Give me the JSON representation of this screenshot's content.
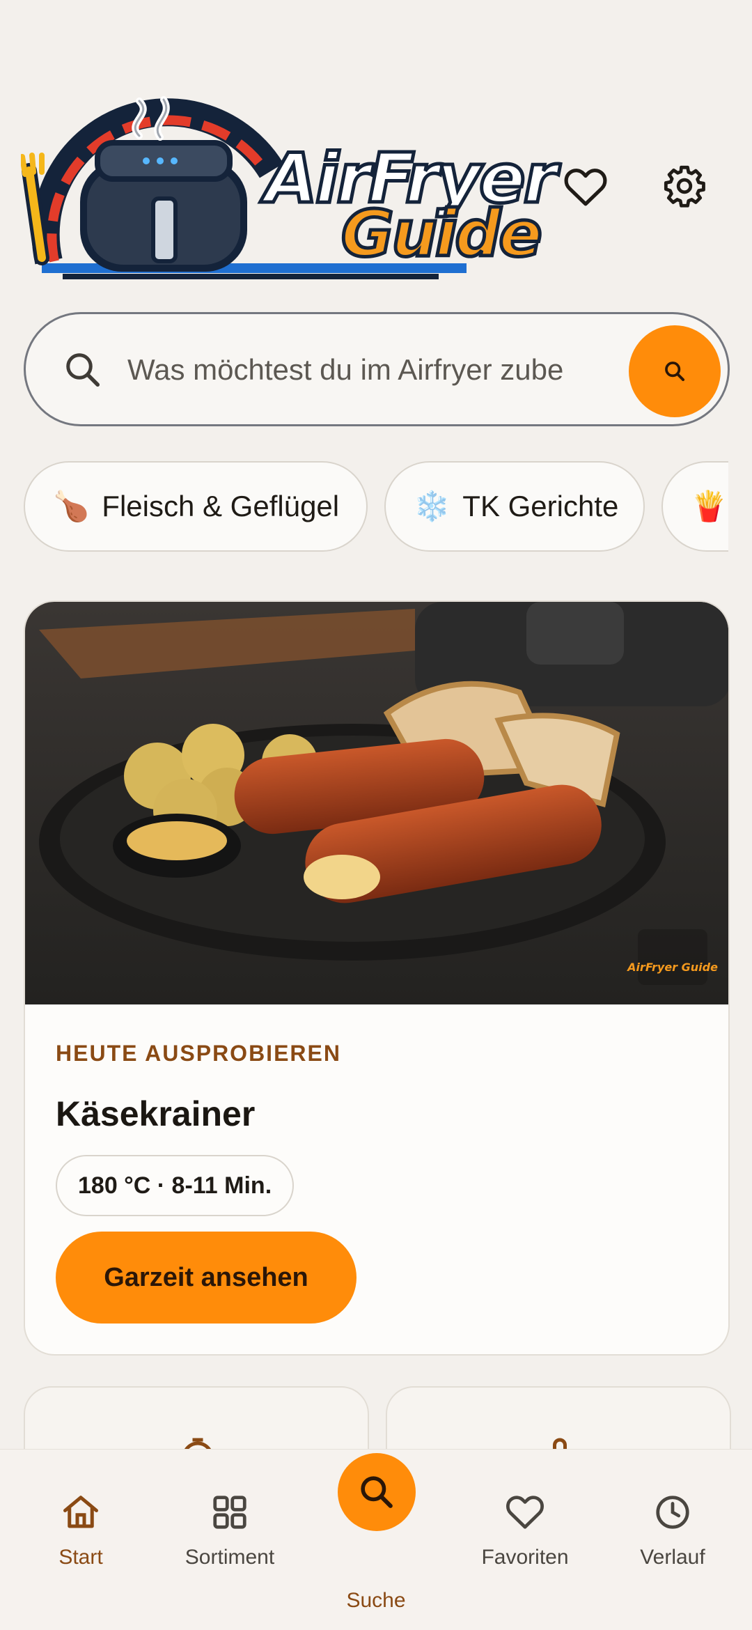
{
  "header": {
    "logo_text_line1": "AirFryer",
    "logo_text_line2": "Guide",
    "icons": [
      "heart-icon",
      "gear-icon"
    ]
  },
  "search": {
    "placeholder": "Was möchtest du im Airfryer zube",
    "button_icon": "search-icon"
  },
  "chips": [
    {
      "emoji": "🍗",
      "label": "Fleisch & Geflügel"
    },
    {
      "emoji": "❄️",
      "label": "TK Gerichte"
    },
    {
      "emoji": "🍟",
      "label": ""
    }
  ],
  "featured": {
    "eyebrow": "HEUTE AUSPROBIEREN",
    "title": "Käsekrainer",
    "meta": "180 °C · 8-11 Min.",
    "cta": "Garzeit ansehen",
    "watermark_text": "AirFryer Guide"
  },
  "nav": {
    "items": [
      {
        "label": "Start",
        "icon": "home-icon"
      },
      {
        "label": "Sortiment",
        "icon": "grid-icon"
      },
      {
        "label": "Suche",
        "icon": "search-icon"
      },
      {
        "label": "Favoriten",
        "icon": "heart-icon"
      },
      {
        "label": "Verlauf",
        "icon": "clock-icon"
      }
    ]
  },
  "colors": {
    "accent": "#ff8c0a",
    "accent_text": "#8a4a14",
    "background": "#f3f0ec"
  }
}
